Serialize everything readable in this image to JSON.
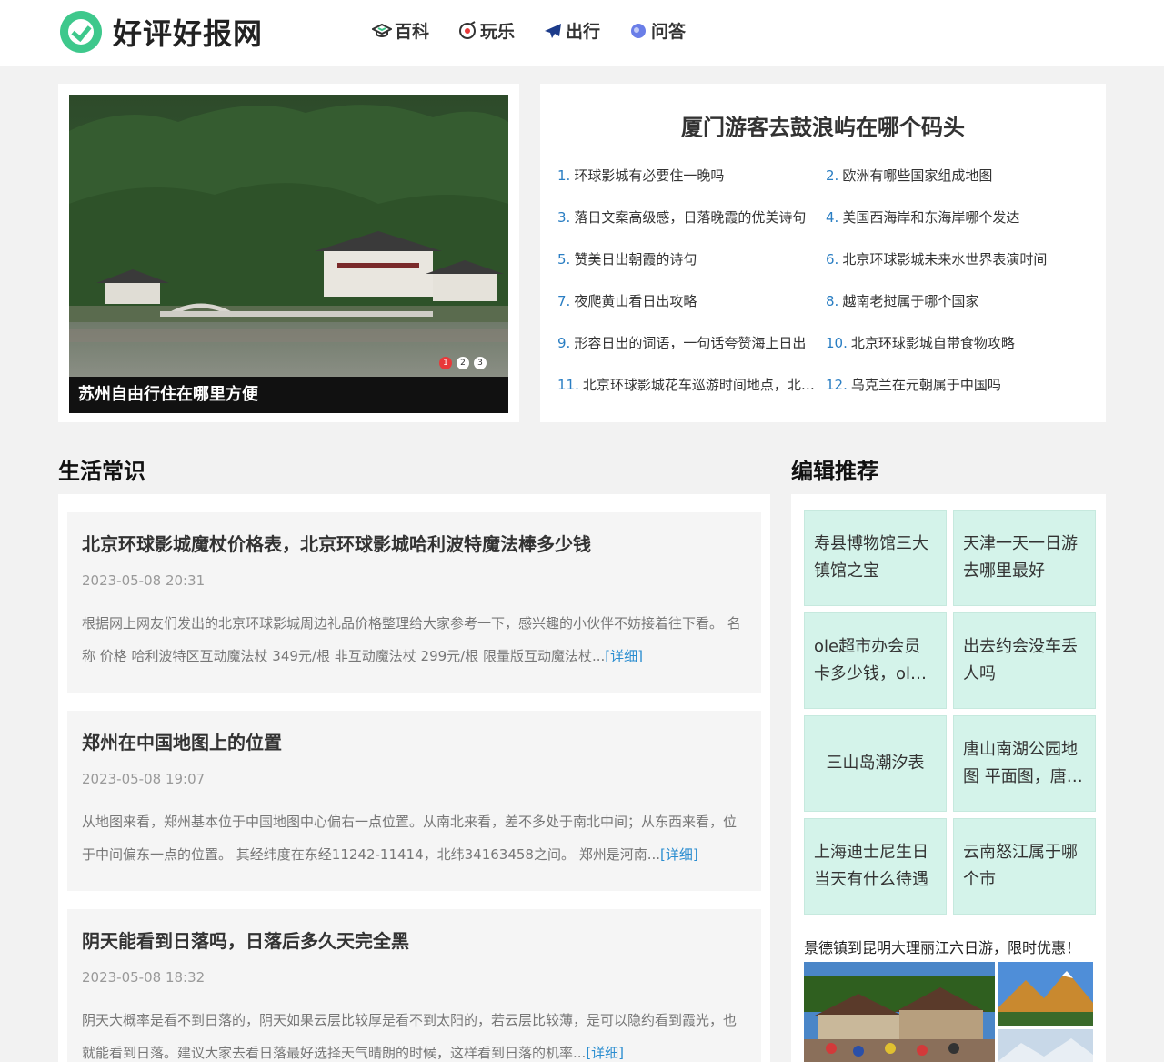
{
  "site": {
    "name": "好评好报网"
  },
  "nav": [
    {
      "label": "百科",
      "icon": "graduation-cap-icon"
    },
    {
      "label": "玩乐",
      "icon": "target-icon"
    },
    {
      "label": "出行",
      "icon": "plane-icon"
    },
    {
      "label": "问答",
      "icon": "chat-bubble-icon"
    }
  ],
  "slider": {
    "caption": "苏州自由行住在哪里方便",
    "dots": [
      "1",
      "2",
      "3"
    ],
    "active_dot": 0
  },
  "hot": {
    "title": "厦门游客去鼓浪屿在哪个码头",
    "items": [
      {
        "num": "1.",
        "text": "环球影城有必要住一晚吗"
      },
      {
        "num": "2.",
        "text": "欧洲有哪些国家组成地图"
      },
      {
        "num": "3.",
        "text": "落日文案高级感，日落晚霞的优美诗句"
      },
      {
        "num": "4.",
        "text": "美国西海岸和东海岸哪个发达"
      },
      {
        "num": "5.",
        "text": "赞美日出朝霞的诗句"
      },
      {
        "num": "6.",
        "text": "北京环球影城未来水世界表演时间"
      },
      {
        "num": "7.",
        "text": "夜爬黄山看日出攻略"
      },
      {
        "num": "8.",
        "text": "越南老挝属于哪个国家"
      },
      {
        "num": "9.",
        "text": "形容日出的词语，一句话夸赞海上日出"
      },
      {
        "num": "10.",
        "text": "北京环球影城自带食物攻略"
      },
      {
        "num": "11.",
        "text": "北京环球影城花车巡游时间地点，北京环球影城花车巡游"
      },
      {
        "num": "12.",
        "text": "乌克兰在元朝属于中国吗"
      }
    ]
  },
  "sections": {
    "life": "生活常识",
    "editor": "编辑推荐"
  },
  "articles": [
    {
      "title": "北京环球影城魔杖价格表，北京环球影城哈利波特魔法棒多少钱",
      "time": "2023-05-08 20:31",
      "summary": "根据网上网友们发出的北京环球影城周边礼品价格整理给大家参考一下，感兴趣的小伙伴不妨接着往下看。 名称 价格 哈利波特区互动魔法杖 349元/根 非互动魔法杖 299元/根 限量版互动魔法杖...",
      "more": "[详细]"
    },
    {
      "title": "郑州在中国地图上的位置",
      "time": "2023-05-08 19:07",
      "summary": "从地图来看，郑州基本位于中国地图中心偏右一点位置。从南北来看，差不多处于南北中间；从东西来看，位于中间偏东一点的位置。 其经纬度在东经11242-11414，北纬34163458之间。 郑州是河南...",
      "more": "[详细]"
    },
    {
      "title": "阴天能看到日落吗，日落后多久天完全黑",
      "time": "2023-05-08 18:32",
      "summary": "阴天大概率是看不到日落的，阴天如果云层比较厚是看不到太阳的，若云层比较薄，是可以隐约看到霞光，也就能看到日落。建议大家去看日落最好选择天气晴朗的时候，这样看到日落的机率...",
      "more": "[详细]"
    }
  ],
  "recommend": [
    "寿县博物馆三大镇馆之宝",
    "天津一天一日游去哪里最好",
    "ole超市办会员卡多少钱，ole超市会员卡有什么用",
    "出去约会没车丢人吗",
    "三山岛潮汐表",
    "唐山南湖公园地图 平面图，唐山南湖公园",
    "上海迪士尼生日当天有什么待遇",
    "云南怒江属于哪个市"
  ],
  "ad": {
    "title": "景德镇到昆明大理丽江六日游，限时优惠！"
  }
}
